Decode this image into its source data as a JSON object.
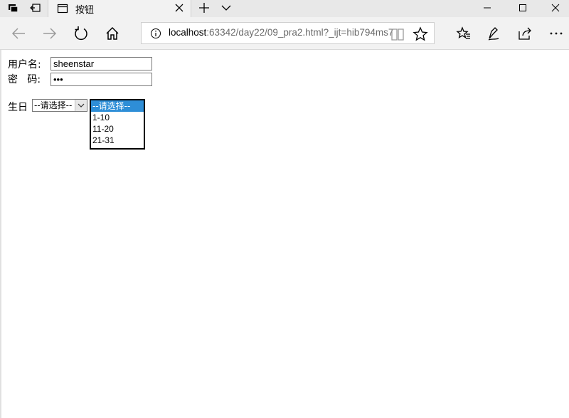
{
  "browser": {
    "tab_title": "按钮",
    "address": {
      "host": "localhost",
      "rest": ":63342/day22/09_pra2.html?_ijt=hib794ms7"
    },
    "icons": [
      "tab-actions-icon",
      "set-aside-tabs-icon",
      "tab-page-icon",
      "tab-close-icon",
      "new-tab-icon",
      "tab-preview-icon",
      "minimize-icon",
      "maximize-icon",
      "window-close-icon",
      "back-icon",
      "forward-icon",
      "refresh-icon",
      "home-icon",
      "site-info-icon",
      "reading-view-icon",
      "favorite-star-icon",
      "favorites-hub-icon",
      "web-note-icon",
      "share-icon",
      "more-icon"
    ]
  },
  "form": {
    "username_label": "用户名:",
    "username_value": "sheenstar",
    "password_label": "密   码:",
    "password_value": "abc",
    "birthday_label": "生日",
    "select_closed_value": "--请选择--",
    "list_options": [
      "--请选择--",
      "1-10",
      "11-20",
      "21-31"
    ],
    "selected_index": 0
  },
  "colors": {
    "selection_bg": "#2e8ed7",
    "toolbar_bg": "#f2f2f2",
    "tabstrip_bg": "#e8e8e8"
  }
}
